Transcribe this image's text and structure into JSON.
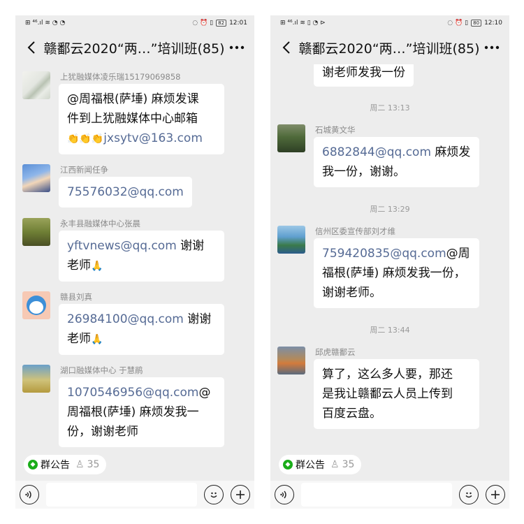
{
  "screens": [
    {
      "status": {
        "left": "⊞ ⁴⁶.ıl ≋ ◔ ◔",
        "vibrate": "◌ ⏰ ▯",
        "battery": "82",
        "time": "12:01"
      },
      "header": {
        "title": "赣鄱云2020“两…”培训班(85)"
      },
      "messages": [
        {
          "sender": "上犹融媒体凌乐瑞15179069858",
          "line1": "@周福根(萨埵) 麻烦发课",
          "line2": "件到上犹融媒体中心邮箱",
          "emoji": "👏👏👏",
          "link": "jxsytv@163.com"
        },
        {
          "sender": "江西新闻任争",
          "link": "75576032@qq.com"
        },
        {
          "sender": "永丰县融媒体中心张晨",
          "link": "yftvnews@qq.com",
          "after": " 谢谢",
          "line2": "老师",
          "emoji": "🙏"
        },
        {
          "sender": "赣县刘真",
          "link": "26984100@qq.com",
          "after": " 谢谢",
          "line2": "老师",
          "emoji": "🙏"
        },
        {
          "sender": "湖口融媒体中心 于慧鹃",
          "link": "1070546956@qq.com",
          "after": "@",
          "line2": "周福根(萨埵) 麻烦发我一",
          "line3": "份，谢谢老师"
        }
      ],
      "notice": {
        "label": "群公告",
        "count": "35"
      }
    },
    {
      "status": {
        "left": "⊞ ⁴⁶.ıl ≋ ▯ ◔ ⊳",
        "vibrate": "◌ ⏰ ▯",
        "battery": "80",
        "time": "12:10"
      },
      "header": {
        "title": "赣鄱云2020“两…”培训班(85)"
      },
      "top_partial": "谢老师发我一份",
      "time1": "周二 13:13",
      "msg1": {
        "sender": "石城黄文华",
        "link": "6882844@qq.com",
        "after": " 麻烦发",
        "line2": "我一份，谢谢。"
      },
      "time2": "周二 13:29",
      "msg2": {
        "sender": "信州区委宣传部刘才维",
        "link": "759420835@qq.com",
        "after": "@周",
        "line2": "福根(萨埵) 麻烦发我一份，",
        "line3": "谢谢老师。"
      },
      "time3": "周二 13:44",
      "msg3": {
        "sender": "邱虎赣鄱云",
        "line1": "算了，这么多人要，那还",
        "line2": "是我让赣鄱云人员上传到",
        "line3": "百度云盘。"
      },
      "notice": {
        "label": "群公告",
        "count": "35"
      }
    }
  ],
  "colors": {
    "link": "#566b95",
    "chat_bg": "#ededed",
    "notice_green": "#1aad19"
  },
  "icons": [
    "back-icon",
    "more-icon",
    "voice-icon",
    "emoji-icon",
    "plus-icon",
    "notice-icon",
    "member-icon"
  ]
}
